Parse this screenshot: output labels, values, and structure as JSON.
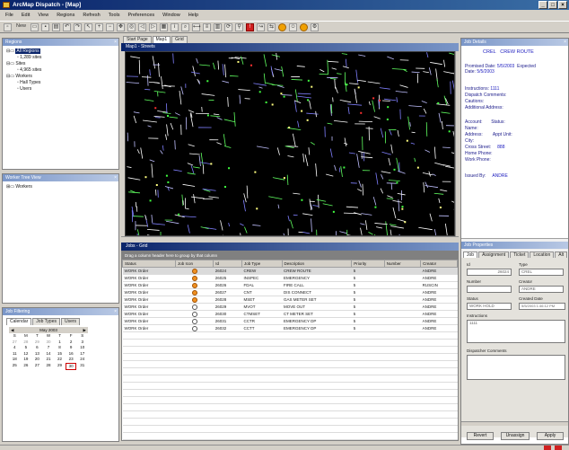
{
  "window": {
    "title": "ArcMap Dispatch - [Map]",
    "controls": [
      "_",
      "□",
      "×"
    ]
  },
  "menu": [
    "File",
    "Edit",
    "View",
    "Regions",
    "Refresh",
    "Tools",
    "Preferences",
    "Window",
    "Help"
  ],
  "toolbar": {
    "new_label": "New"
  },
  "left_top": {
    "title": "Regions",
    "tree": [
      "All Regions",
      "1,289 sites",
      "Sites",
      "4,965 sites",
      "Workers",
      "Hall Types",
      "Users"
    ]
  },
  "left_mid": {
    "title": "Worker Tree View",
    "tree": [
      "Workers"
    ]
  },
  "left_bottom": {
    "title": "Job Filtering",
    "tabs": [
      "Calendar",
      "Job Types",
      "Users"
    ],
    "calendar": {
      "month": "May 2003",
      "days": [
        "S",
        "M",
        "T",
        "W",
        "T",
        "F",
        "S"
      ],
      "dates": [
        "27",
        "28",
        "29",
        "30",
        "1",
        "2",
        "3",
        "4",
        "5",
        "6",
        "7",
        "8",
        "9",
        "10",
        "11",
        "12",
        "13",
        "14",
        "15",
        "16",
        "17",
        "18",
        "19",
        "20",
        "21",
        "22",
        "23",
        "24",
        "25",
        "26",
        "27",
        "28",
        "29",
        "30",
        "31"
      ],
      "today": "30"
    }
  },
  "center_tabs": [
    "Start Page",
    "Map1",
    "Grid"
  ],
  "map": {
    "title": "Map1 - Streets"
  },
  "grid": {
    "title": "Jobs - Grid",
    "group_hint": "Drag a column header here to group by that column",
    "columns": [
      "Status",
      "Job Icon",
      "Id",
      "Job Type",
      "Description",
      "Priority",
      "Number",
      "Creator"
    ],
    "rows": [
      {
        "status": "WORK Order",
        "icon": "filled",
        "id": "26024",
        "type": "CREW",
        "desc": "CREW ROUTE",
        "prio": "5",
        "num": "",
        "creator": "ANDRE"
      },
      {
        "status": "WORK Order",
        "icon": "filled",
        "id": "26025",
        "type": "INSPEC",
        "desc": "EMERGENCY",
        "prio": "5",
        "num": "",
        "creator": "ANDRE"
      },
      {
        "status": "WORK Order",
        "icon": "filled",
        "id": "26026",
        "type": "FDAL",
        "desc": "FIRE CALL",
        "prio": "5",
        "num": "",
        "creator": "RUSCIN"
      },
      {
        "status": "WORK Order",
        "icon": "filled",
        "id": "26027",
        "type": "CNT",
        "desc": "DIS CONNECT",
        "prio": "5",
        "num": "",
        "creator": "ANDRE"
      },
      {
        "status": "WORK Order",
        "icon": "filled",
        "id": "26028",
        "type": "MSET",
        "desc": "GAS METER SET",
        "prio": "5",
        "num": "",
        "creator": "ANDRE"
      },
      {
        "status": "WORK Order",
        "icon": "ring",
        "id": "26029",
        "type": "MVOT",
        "desc": "MOVE OUT",
        "prio": "5",
        "num": "",
        "creator": "ANDRE"
      },
      {
        "status": "WORK Order",
        "icon": "ring",
        "id": "26030",
        "type": "CTMSET",
        "desc": "CT METER SET",
        "prio": "5",
        "num": "",
        "creator": "ANDRE"
      },
      {
        "status": "WORK Order",
        "icon": "ring",
        "id": "26031",
        "type": "CCTR",
        "desc": "EMERGENCY DP",
        "prio": "5",
        "num": "",
        "creator": "ANDRE"
      },
      {
        "status": "WORK Order",
        "icon": "ring",
        "id": "26032",
        "type": "CCTT",
        "desc": "EMERGENCY DP",
        "prio": "5",
        "num": "",
        "creator": "ANDRE"
      }
    ]
  },
  "detail": {
    "title": "CREW ROUTE",
    "head_left": "CREL",
    "promised_label": "Promised Date:",
    "promised_value": "5/5/2003",
    "expected_label": "Expected",
    "date_label": "Date:",
    "date_value": "5/5/2003",
    "instructions_label": "Instructions:",
    "instructions_value": "1111",
    "dispatch_label": "Dispatch Comments:",
    "cautions_label": "Cautions:",
    "additional_label": "Additional Address:",
    "account_label": "Account:",
    "status_label": "Status:",
    "name_label": "Name:",
    "address_label": "Address:",
    "appt_label": "Appt Unit:",
    "city_label": "City:",
    "cross_label": "Cross Street:",
    "cross_value": "888",
    "home_label": "Home Phone:",
    "work_label": "Work Phone:",
    "issued_label": "Issued By:",
    "issued_value": "ANDRE"
  },
  "props": {
    "title": "Job Properties",
    "tabs": [
      "Job",
      "Assignment",
      "Ticket",
      "Location",
      "Alt"
    ],
    "fields": {
      "id_label": "Id",
      "id_value": "26024",
      "type_label": "Type",
      "type_value": "CREL",
      "number_label": "Number",
      "creator_label": "Creator",
      "creator_value": "ANDRE",
      "status_label": "Status",
      "status_value": "WORK HOLD",
      "created_label": "Created Date",
      "created_value": "5/5/2003 1:46:12 PM",
      "instructions_label": "Instructions",
      "instructions_value": "1111",
      "dispatcher_label": "Dispatcher Comments"
    },
    "buttons": [
      "Revert",
      "Unassign",
      "Apply"
    ]
  },
  "colors": {
    "titlebar": "#0a246a",
    "map_bg": "#000000",
    "accent_blue": "#2020c0",
    "job_icon": "#f09020"
  }
}
